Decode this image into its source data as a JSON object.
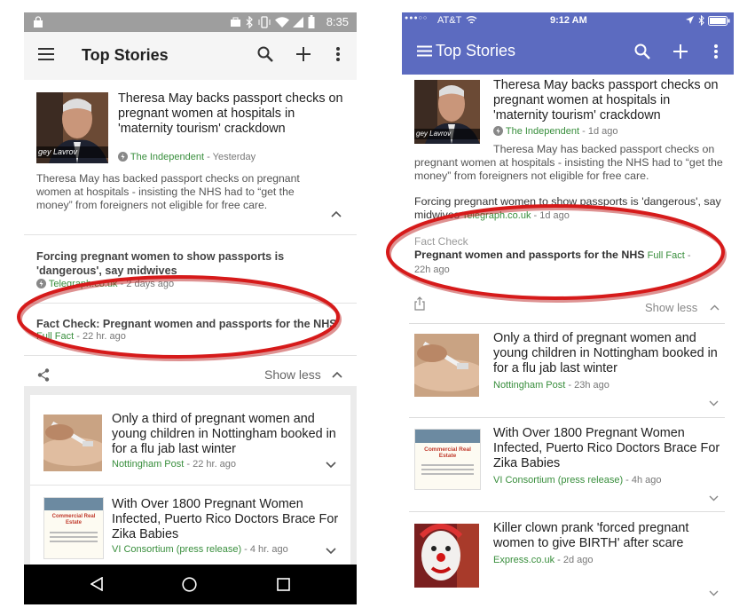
{
  "android": {
    "status_time": "8:35",
    "title": "Top Stories",
    "story": {
      "headline": "Theresa May backs passport checks on pregnant women at hospitals in 'maternity tourism' crackdown",
      "thumb_caption": "gey Lavrov",
      "source": "The Independent",
      "age": " - Yesterday",
      "snippet": "Theresa May has backed passport checks on pregnant women at hospitals - insisting the NHS had to “get the money” from foreigners not eligible for free care."
    },
    "related": {
      "headline": "Forcing pregnant women to show passports is 'dangerous', say midwives",
      "source": "Telegraph.co.uk",
      "age": " - 2 days ago"
    },
    "fact_check": {
      "headline": "Fact Check: Pregnant women and passports for the NHS",
      "source": "Full Fact",
      "age": " - 22 hr. ago"
    },
    "show_less": "Show less",
    "items": [
      {
        "headline": "Only a third of pregnant women and young children in Nottingham booked in for a flu jab last winter",
        "source": "Nottingham Post",
        "age": " - 22 hr. ago"
      },
      {
        "headline": "With Over 1800 Pregnant Women Infected, Puerto Rico Doctors Brace For Zika Babies",
        "source": "VI Consortium (press release)",
        "age": " - 4 hr. ago",
        "ad_text": "Commercial Real Estate"
      }
    ]
  },
  "ios": {
    "carrier": "AT&T",
    "time": "9:12 AM",
    "title": "Top Stories",
    "story": {
      "headline": "Theresa May backs passport checks on pregnant women at hospitals in 'maternity tourism' crackdown",
      "thumb_caption": "gey Lavrov",
      "source": "The Independent",
      "age": " - 1d ago",
      "snippet": "Theresa May has backed passport checks on pregnant women at hospitals - insisting the NHS had to “get the money” from foreigners not eligible for free care."
    },
    "related": {
      "headline": "Forcing pregnant women to show passports is 'dangerous', say midwives",
      "source": "Telegraph.co.uk",
      "age": " - 1d ago"
    },
    "fact_check": {
      "label": "Fact Check",
      "headline": "Pregnant women and passports for the NHS",
      "source": "Full Fact",
      "age_sep": " -",
      "age": "22h ago"
    },
    "show_less": "Show less",
    "items": [
      {
        "headline": "Only a third of pregnant women and young children in Nottingham booked in for a flu jab last winter",
        "source": "Nottingham Post",
        "age": " - 23h ago"
      },
      {
        "headline": "With Over 1800 Pregnant Women Infected, Puerto Rico Doctors Brace For Zika Babies",
        "source": "VI Consortium (press release)",
        "age": " - 4h ago",
        "ad_text": "Commercial Real Estate"
      },
      {
        "headline": "Killer clown prank 'forced pregnant women to give BIRTH' after scare",
        "source": "Express.co.uk",
        "age": " - 2d ago"
      }
    ]
  },
  "colors": {
    "android_toolbar": "#f5f5f5",
    "ios_header": "#5c6bc0",
    "source_green": "#388e3c",
    "highlight_red": "#d61a1a"
  }
}
